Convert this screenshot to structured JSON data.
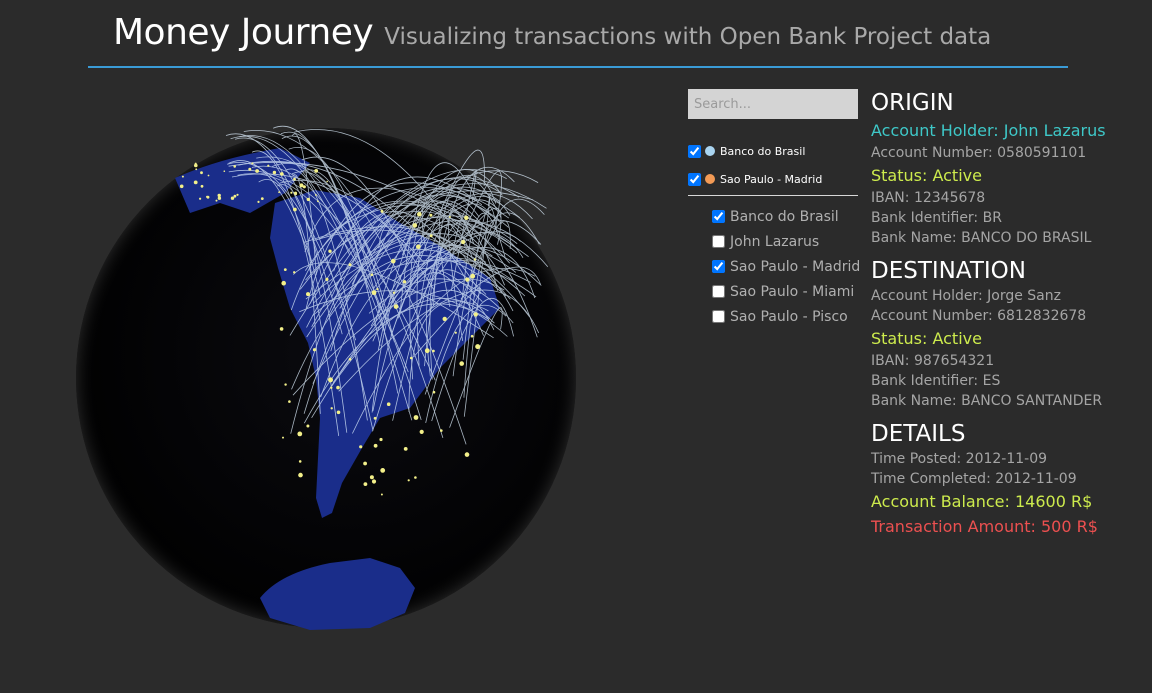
{
  "header": {
    "title": "Money Journey",
    "subtitle": "Visualizing transactions with Open Bank Project data"
  },
  "search": {
    "placeholder": "Search..."
  },
  "legend": [
    {
      "label": "Banco do Brasil",
      "checked": true,
      "color": "#a9d4f0"
    },
    {
      "label": "Sao Paulo - Madrid",
      "checked": true,
      "color": "#f29a55"
    }
  ],
  "filters": [
    {
      "label": "Banco do Brasil",
      "checked": true
    },
    {
      "label": "John Lazarus",
      "checked": false
    },
    {
      "label": "Sao Paulo - Madrid",
      "checked": true
    },
    {
      "label": "Sao Paulo - Miami",
      "checked": false
    },
    {
      "label": "Sao Paulo - Pisco",
      "checked": false
    }
  ],
  "origin": {
    "title": "ORIGIN",
    "holder": "Account Holder: John Lazarus",
    "number": "Account Number: 0580591101",
    "status": "Status: Active",
    "iban": "IBAN: 12345678",
    "bank_id": "Bank Identifier: BR",
    "bank_name": "Bank Name: BANCO DO BRASIL"
  },
  "destination": {
    "title": "DESTINATION",
    "holder": "Account Holder: Jorge Sanz",
    "number": "Account Number: 6812832678",
    "status": "Status: Active",
    "iban": "IBAN: 987654321",
    "bank_id": "Bank Identifier: ES",
    "bank_name": "Bank Name: BANCO SANTANDER"
  },
  "details": {
    "title": "DETAILS",
    "posted": "Time Posted: 2012-11-09",
    "completed": "Time Completed: 2012-11-09",
    "balance": "Account Balance: 14600 R$",
    "amount": "Transaction Amount: 500 R$"
  },
  "colors": {
    "background": "#2b2b2b",
    "accent_rule": "#3a9bd6",
    "holder_highlight": "#3ec8c8",
    "status": "#cdeb4d",
    "amount": "#ec5050",
    "land": "#1a2d8a",
    "arcs": "#dff0ff"
  }
}
